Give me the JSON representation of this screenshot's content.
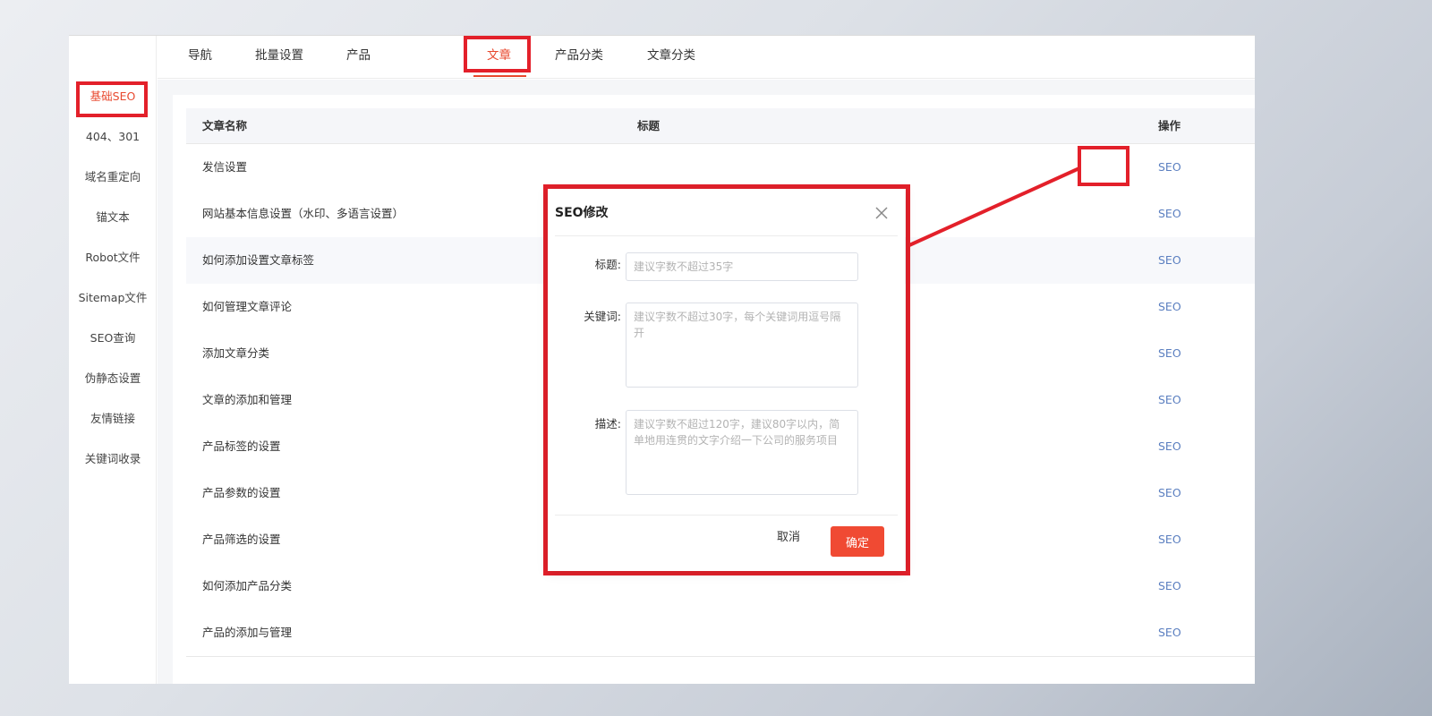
{
  "sidebar": {
    "items": [
      {
        "label": "基础SEO",
        "active": true
      },
      {
        "label": "404、301"
      },
      {
        "label": "域名重定向"
      },
      {
        "label": "锚文本"
      },
      {
        "label": "Robot文件"
      },
      {
        "label": "Sitemap文件"
      },
      {
        "label": "SEO查询"
      },
      {
        "label": "伪静态设置"
      },
      {
        "label": "友情链接"
      },
      {
        "label": "关键词收录"
      }
    ]
  },
  "tabs": [
    {
      "label": "导航"
    },
    {
      "label": "批量设置"
    },
    {
      "label": "产品"
    },
    {
      "label": "文章",
      "active": true
    },
    {
      "label": "产品分类"
    },
    {
      "label": "文章分类"
    }
  ],
  "table": {
    "headers": {
      "name": "文章名称",
      "title": "标题",
      "op": "操作"
    },
    "rows": [
      {
        "name": "发信设置",
        "op": "SEO"
      },
      {
        "name": "网站基本信息设置（水印、多语言设置）",
        "op": "SEO"
      },
      {
        "name": "如何添加设置文章标签",
        "op": "SEO"
      },
      {
        "name": "如何管理文章评论",
        "op": "SEO"
      },
      {
        "name": "添加文章分类",
        "op": "SEO"
      },
      {
        "name": "文章的添加和管理",
        "op": "SEO"
      },
      {
        "name": "产品标签的设置",
        "op": "SEO"
      },
      {
        "name": "产品参数的设置",
        "op": "SEO"
      },
      {
        "name": "产品筛选的设置",
        "op": "SEO"
      },
      {
        "name": "如何添加产品分类",
        "op": "SEO"
      },
      {
        "name": "产品的添加与管理",
        "op": "SEO"
      }
    ]
  },
  "modal": {
    "title": "SEO修改",
    "fields": {
      "title_label": "标题:",
      "title_placeholder": "建议字数不超过35字",
      "keywords_label": "关键词:",
      "keywords_placeholder": "建议字数不超过30字，每个关键词用逗号隔开",
      "desc_label": "描述:",
      "desc_placeholder": "建议字数不超过120字，建议80字以内，简单地用连贯的文字介绍一下公司的服务项目"
    },
    "cancel_label": "取消",
    "ok_label": "确定"
  },
  "colors": {
    "accent": "#e8492f",
    "highlight_box": "#e3202a",
    "link": "#5b7fc0",
    "primary_button": "#f04a33"
  },
  "icons": {
    "close": "close-icon"
  }
}
